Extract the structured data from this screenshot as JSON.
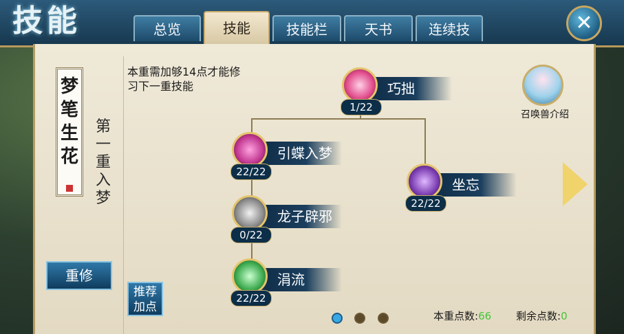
{
  "header": {
    "title": "技能",
    "tabs": [
      {
        "label": "总览",
        "active": false
      },
      {
        "label": "技能",
        "active": true
      },
      {
        "label": "技能栏",
        "active": false
      },
      {
        "label": "天书",
        "active": false
      },
      {
        "label": "连续技",
        "active": false
      }
    ],
    "close_icon": "close-icon"
  },
  "left": {
    "scroll_title": "梦笔生花",
    "stage_label": "第一重入梦",
    "reset_label": "重修",
    "recommend_label": "推荐加点"
  },
  "main": {
    "requirement_text": "本重需加够14点才能修习下一重技能",
    "skills": [
      {
        "name": "巧拙",
        "count": "1/22",
        "icon": "pink-crystal-icon",
        "color": "#e04a8a"
      },
      {
        "name": "引蝶入梦",
        "count": "22/22",
        "icon": "butterfly-icon",
        "color": "#c0368f"
      },
      {
        "name": "坐忘",
        "count": "22/22",
        "icon": "purple-shard-icon",
        "color": "#7a3cb0"
      },
      {
        "name": "龙子辟邪",
        "count": "0/22",
        "icon": "grey-dragon-icon",
        "color": "#8a8a8a"
      },
      {
        "name": "涓流",
        "count": "22/22",
        "icon": "green-figure-icon",
        "color": "#3caa4e"
      }
    ],
    "summon_label": "召唤兽介绍"
  },
  "footer": {
    "stage_points_label": "本重点数:",
    "stage_points_value": "66",
    "remaining_points_label": "剩余点数:",
    "remaining_points_value": "0",
    "page_dots": 3,
    "active_dot": 0
  }
}
